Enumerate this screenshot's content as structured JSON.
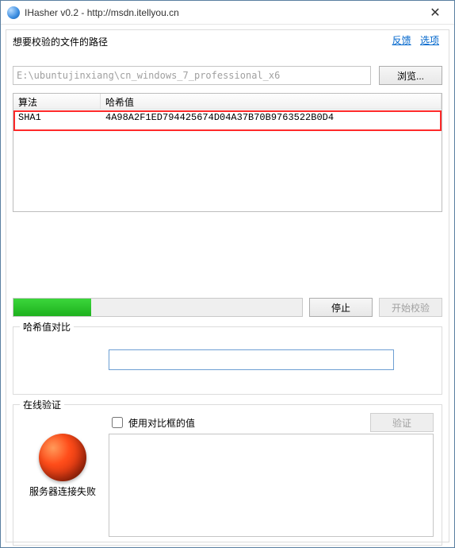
{
  "window": {
    "title": "IHasher v0.2 - http://msdn.itellyou.cn"
  },
  "links": {
    "feedback": "反馈",
    "options": "选项"
  },
  "labels": {
    "path": "想要校验的文件的路径",
    "browse": "浏览...",
    "stop": "停止",
    "start": "开始校验",
    "compare": "哈希值对比",
    "online": "在线验证",
    "useCompare": "使用对比框的值",
    "verify": "验证",
    "serverFail": "服务器连接失败"
  },
  "path": {
    "value": "E:\\ubuntujinxiang\\cn_windows_7_professional_x6"
  },
  "columns": {
    "algo": "算法",
    "hash": "哈希值"
  },
  "rows": [
    {
      "algo": "SHA1",
      "hash": "4A98A2F1ED794425674D04A37B70B9763522B0D4"
    }
  ],
  "progress": {
    "percent": 27
  },
  "compareValue": "",
  "useCompareChecked": false
}
